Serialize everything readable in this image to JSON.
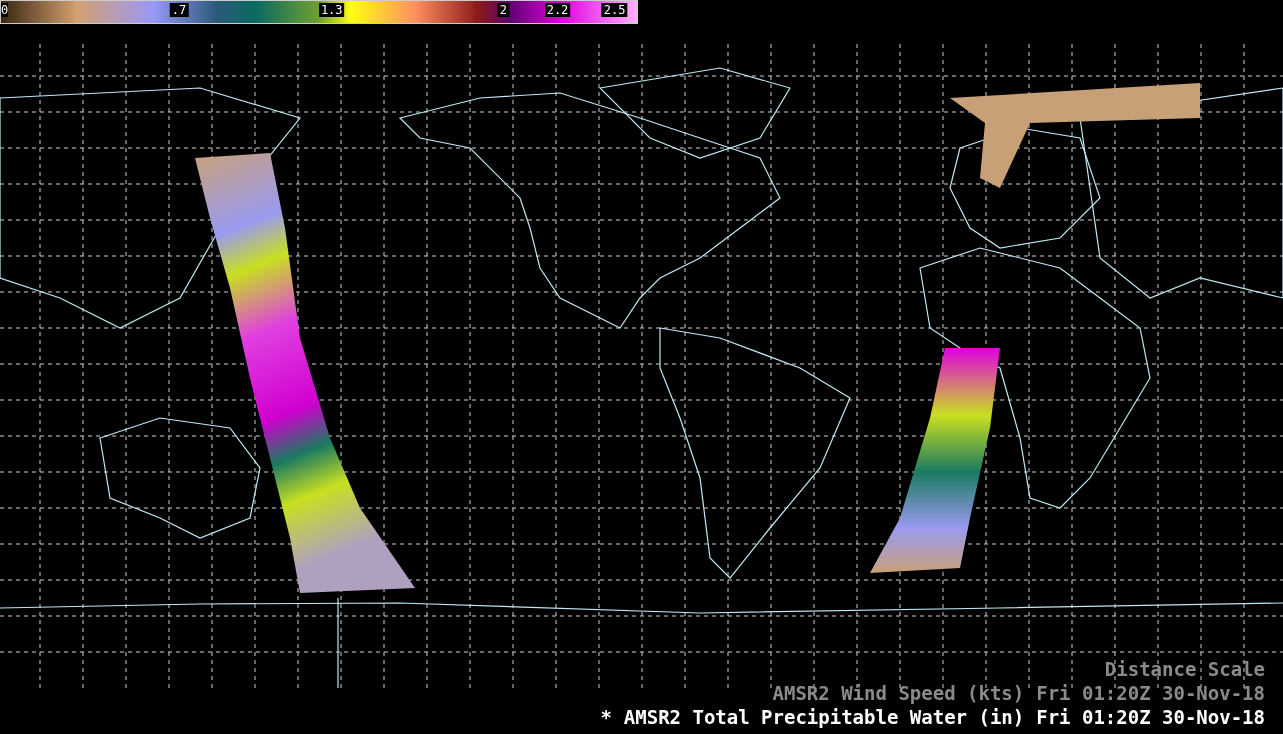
{
  "colorbar": {
    "ticks": [
      {
        "label": "0",
        "level": 0
      },
      {
        "label": ".7",
        "level": 0.28
      },
      {
        "label": "1.3",
        "level": 0.52
      },
      {
        "label": "2",
        "level": 0.79
      },
      {
        "label": "2.2",
        "level": 0.875
      },
      {
        "label": "2.5",
        "level": 0.985
      }
    ]
  },
  "legend": [
    {
      "label": "Distance Scale",
      "selected": false
    },
    {
      "label": "AMSR2 Wind Speed (kts)",
      "time": "Fri 01:20Z 30-Nov-18",
      "selected": false
    },
    {
      "marker": "*",
      "label": "AMSR2 Total Precipitable Water (in)",
      "time": "Fri 01:20Z 30-Nov-18",
      "selected": true
    }
  ]
}
